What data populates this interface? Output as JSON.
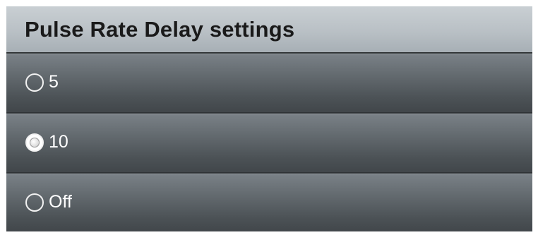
{
  "header": {
    "title": "Pulse Rate Delay settings"
  },
  "options": [
    {
      "label": "5",
      "selected": false
    },
    {
      "label": "10",
      "selected": true
    },
    {
      "label": "Off",
      "selected": false
    }
  ],
  "colors": {
    "header_bg": "#bcc3c8",
    "option_bg": "#5b6267",
    "text": "#ffffff",
    "title_text": "#1a1a1a"
  }
}
